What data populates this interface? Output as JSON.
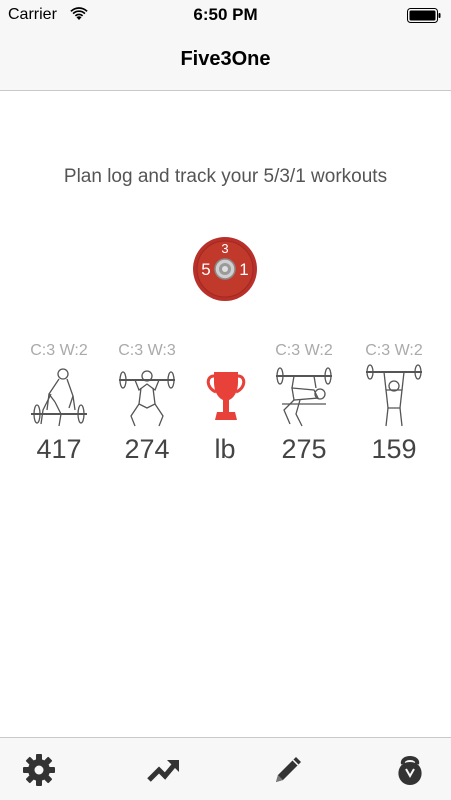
{
  "status_bar": {
    "carrier": "Carrier",
    "time": "6:50 PM",
    "wifi_icon": "wifi-icon",
    "battery_icon": "battery-icon"
  },
  "nav": {
    "title": "Five3One"
  },
  "main": {
    "tagline": "Plan log and track your 5/3/1 workouts",
    "logo": {
      "icon": "531-plate-logo-icon",
      "top_digit": "3",
      "left_digit": "5",
      "right_digit": "1",
      "color": "#c0392b"
    },
    "lifts": [
      {
        "id": "deadlift",
        "cycle": "C:3 W:2",
        "value": "417",
        "icon": "deadlift-figure-icon"
      },
      {
        "id": "squat",
        "cycle": "C:3 W:3",
        "value": "274",
        "icon": "squat-figure-icon"
      },
      {
        "id": "unit",
        "cycle": "",
        "value": "lb",
        "icon": "trophy-icon"
      },
      {
        "id": "bench",
        "cycle": "C:3 W:2",
        "value": "275",
        "icon": "bench-press-figure-icon"
      },
      {
        "id": "overhead",
        "cycle": "C:3 W:2",
        "value": "159",
        "icon": "overhead-press-figure-icon"
      }
    ],
    "accent_color": "#e8413a"
  },
  "tab_bar": {
    "tabs": [
      {
        "id": "settings",
        "icon": "gear-icon"
      },
      {
        "id": "progress",
        "icon": "trending-up-icon"
      },
      {
        "id": "edit",
        "icon": "pencil-icon"
      },
      {
        "id": "about",
        "icon": "kettlebell-icon"
      }
    ],
    "icon_color": "#333333"
  }
}
